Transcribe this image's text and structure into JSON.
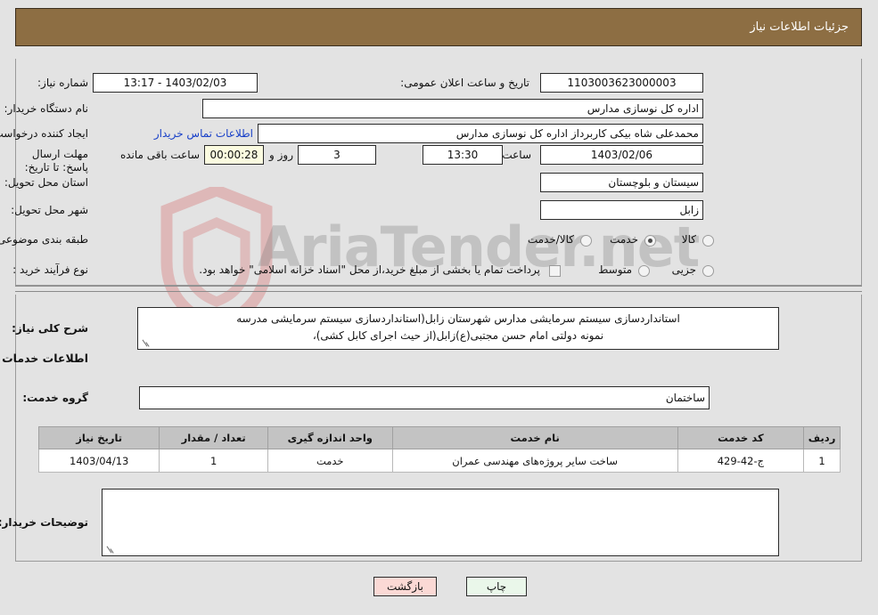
{
  "header": {
    "title": "جزئیات اطلاعات نیاز"
  },
  "watermark": {
    "text": "AriaTender.net"
  },
  "form": {
    "need_number": {
      "label": "شماره نیاز:",
      "value": "1103003623000003"
    },
    "announce_datetime": {
      "label": "تاریخ و ساعت اعلان عمومی:",
      "value": "1403/02/03 - 13:17"
    },
    "buyer_org": {
      "label": "نام دستگاه خریدار:",
      "value": "اداره کل نوسازی مدارس"
    },
    "request_creator": {
      "label": "ایجاد کننده درخواست:",
      "value": "محمدعلی شاه بیکی کاربرداز اداره کل نوسازی مدارس"
    },
    "buyer_contact_link": "اطلاعات تماس خریدار",
    "deadline": {
      "label": "مهلت ارسال پاسخ: تا تاریخ:",
      "date": "1403/02/06",
      "time_label": "ساعت",
      "time": "13:30",
      "days": "3",
      "days_label": "روز و",
      "countdown": "00:00:28",
      "remaining_label": "ساعت باقی مانده"
    },
    "province": {
      "label": "استان محل تحویل:",
      "value": "سیستان و بلوچستان"
    },
    "city": {
      "label": "شهر محل تحویل:",
      "value": "زابل"
    },
    "classification": {
      "label": "طبقه بندی موضوعی:",
      "options": [
        {
          "label": "کالا",
          "selected": false
        },
        {
          "label": "خدمت",
          "selected": true
        },
        {
          "label": "کالا/خدمت",
          "selected": false
        }
      ]
    },
    "purchase_process": {
      "label": "نوع فرآیند خرید :",
      "options": [
        {
          "label": "جزیی",
          "selected": false
        },
        {
          "label": "متوسط",
          "selected": false
        }
      ],
      "checkbox_label": "پرداخت تمام یا بخشی از مبلغ خرید،از محل \"اسناد خزانه اسلامی\" خواهد بود.",
      "checkbox_checked": false
    },
    "general_description": {
      "label": "شرح کلی نیاز:",
      "line1": "استانداردسازی سیستم سرمایشی مدارس شهرستان زابل(استانداردسازی سیستم سرمایشی مدرسه",
      "line2": "نمونه دولتی امام حسن مجتبی(ع)زابل(از حیث اجرای کابل کشی)،"
    },
    "services_section_title": "اطلاعات خدمات مورد نیاز",
    "service_group": {
      "label": "گروه خدمت:",
      "value": "ساختمان"
    },
    "buyer_notes": {
      "label": "توضیحات خریدار:",
      "value": ""
    }
  },
  "table": {
    "columns": [
      "ردیف",
      "کد خدمت",
      "نام خدمت",
      "واحد اندازه گیری",
      "تعداد / مقدار",
      "تاریخ نیاز"
    ],
    "rows": [
      {
        "row": "1",
        "code": "ج-42-429",
        "name": "ساخت سایر پروژه‌های مهندسی عمران",
        "unit": "خدمت",
        "qty": "1",
        "need_date": "1403/04/13"
      }
    ]
  },
  "footer": {
    "print_label": "چاپ",
    "back_label": "بازگشت"
  }
}
